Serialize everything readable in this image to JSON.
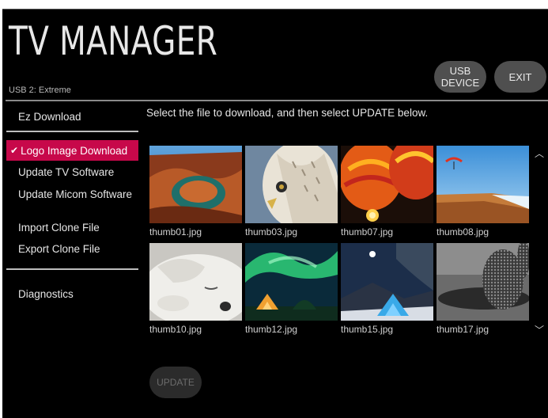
{
  "header": {
    "title": "TV MANAGER",
    "device": "USB 2: Extreme",
    "usb_device_label": "USB DEVICE",
    "exit_label": "EXIT"
  },
  "sidebar": {
    "items": [
      {
        "label": "Ez Download",
        "active": false
      },
      {
        "label": "Logo Image Download",
        "active": true
      },
      {
        "label": "Update TV Software",
        "active": false
      },
      {
        "label": "Update Micom Software",
        "active": false
      },
      {
        "label": "Import Clone File",
        "active": false
      },
      {
        "label": "Export Clone File",
        "active": false
      },
      {
        "label": "Diagnostics",
        "active": false
      }
    ]
  },
  "main": {
    "instruction": "Select the file to download, and then select UPDATE below.",
    "thumbnails": [
      {
        "name": "thumb01.jpg",
        "subject": "canyon-bend"
      },
      {
        "name": "thumb03.jpg",
        "subject": "owl"
      },
      {
        "name": "thumb07.jpg",
        "subject": "hot-air-balloons"
      },
      {
        "name": "thumb08.jpg",
        "subject": "paraglider-cliff"
      },
      {
        "name": "thumb10.jpg",
        "subject": "dog"
      },
      {
        "name": "thumb12.jpg",
        "subject": "aurora-tent"
      },
      {
        "name": "thumb15.jpg",
        "subject": "night-tent"
      },
      {
        "name": "thumb17.jpg",
        "subject": "microphone"
      }
    ],
    "update_label": "UPDATE"
  },
  "colors": {
    "accent": "#c7084a",
    "background": "#000000",
    "button": "#4f4f4f"
  }
}
